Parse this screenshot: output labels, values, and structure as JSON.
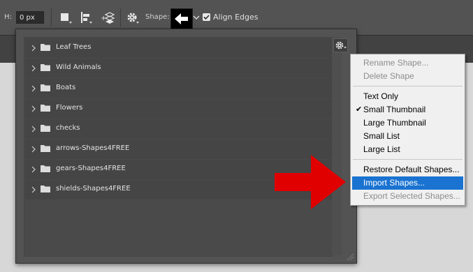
{
  "options_bar": {
    "h_label": "H:",
    "h_value": "0 px",
    "shape_label": "Shape:",
    "align_edges_label": "Align Edges",
    "align_edges_checked": true,
    "icons": [
      "path-operations-icon",
      "path-alignment-icon",
      "path-arrangement-icon",
      "gear-icon",
      "arrow-shape-icon",
      "chevron-down-icon"
    ]
  },
  "picker": {
    "folders": [
      {
        "name": "Leaf Trees"
      },
      {
        "name": "Wild Animals"
      },
      {
        "name": "Boats"
      },
      {
        "name": "Flowers"
      },
      {
        "name": "checks"
      },
      {
        "name": "arrows-Shapes4FREE"
      },
      {
        "name": "gears-Shapes4FREE"
      },
      {
        "name": "shields-Shapes4FREE"
      }
    ]
  },
  "menu": {
    "items": [
      {
        "label": "Rename Shape...",
        "state": "disabled"
      },
      {
        "label": "Delete Shape",
        "state": "disabled"
      },
      {
        "label": "Text Only",
        "state": "normal"
      },
      {
        "label": "Small Thumbnail",
        "state": "checked"
      },
      {
        "label": "Large Thumbnail",
        "state": "normal"
      },
      {
        "label": "Small List",
        "state": "normal"
      },
      {
        "label": "Large List",
        "state": "normal"
      },
      {
        "label": "Restore Default Shapes...",
        "state": "normal"
      },
      {
        "label": "Import Shapes...",
        "state": "highlighted"
      },
      {
        "label": "Export Selected Shapes...",
        "state": "disabled"
      }
    ]
  },
  "colors": {
    "highlight": "#1a73d1",
    "annotation_arrow": "#e00000",
    "panel": "#535353"
  }
}
